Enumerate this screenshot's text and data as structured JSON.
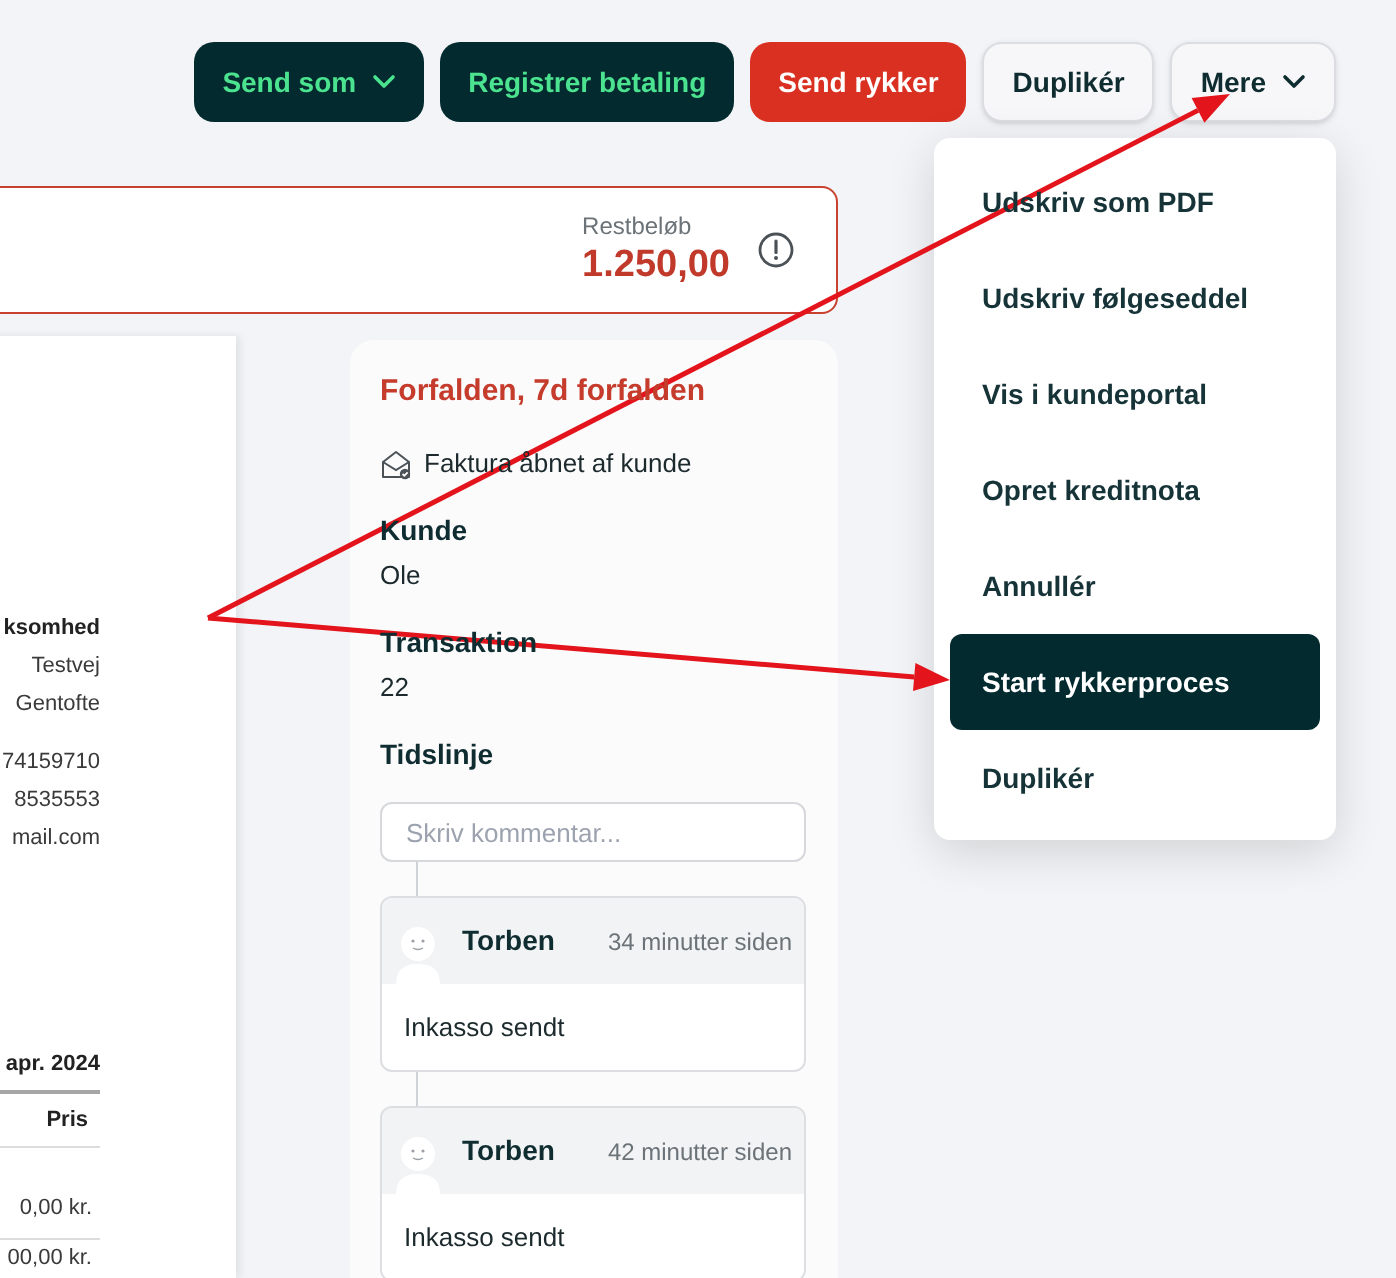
{
  "toolbar": {
    "buttons": [
      {
        "label": "Send som",
        "kind": "primary",
        "dropdown": true
      },
      {
        "label": "Registrer betaling",
        "kind": "primary",
        "dropdown": false
      },
      {
        "label": "Send rykker",
        "kind": "danger",
        "dropdown": false
      },
      {
        "label": "Duplikér",
        "kind": "secondary",
        "dropdown": false
      },
      {
        "label": "Mere",
        "kind": "secondary",
        "dropdown": true
      }
    ]
  },
  "balance": {
    "label": "Restbeløb",
    "amount": "1.250,00"
  },
  "document": {
    "company": "ksomhed",
    "address_lines": [
      "Testvej",
      "Gentofte"
    ],
    "contact_lines": [
      "74159710",
      "8535553",
      "mail.com"
    ],
    "date": "apr. 2024",
    "table": {
      "columns": [
        "Pris"
      ],
      "rows": [
        [
          "0,00 kr."
        ],
        [
          "00,00 kr."
        ]
      ]
    }
  },
  "status_panel": {
    "status": "Forfalden, 7d forfalden",
    "event": "Faktura åbnet af kunde",
    "fields": [
      {
        "label": "Kunde",
        "value": "Ole"
      },
      {
        "label": "Transaktion",
        "value": "22"
      }
    ],
    "timeline": {
      "title": "Tidslinje",
      "comment_placeholder": "Skriv kommentar...",
      "entries": [
        {
          "author": "Torben",
          "time": "34 minutter siden",
          "text": "Inkasso sendt"
        },
        {
          "author": "Torben",
          "time": "42 minutter siden",
          "text": "Inkasso sendt"
        }
      ]
    }
  },
  "more_menu": {
    "items": [
      {
        "label": "Udskriv som PDF",
        "selected": false
      },
      {
        "label": "Udskriv følgeseddel",
        "selected": false
      },
      {
        "label": "Vis i kundeportal",
        "selected": false
      },
      {
        "label": "Opret kreditnota",
        "selected": false
      },
      {
        "label": "Annullér",
        "selected": false
      },
      {
        "label": "Start rykkerproces",
        "selected": true
      },
      {
        "label": "Duplikér",
        "selected": false
      }
    ]
  }
}
